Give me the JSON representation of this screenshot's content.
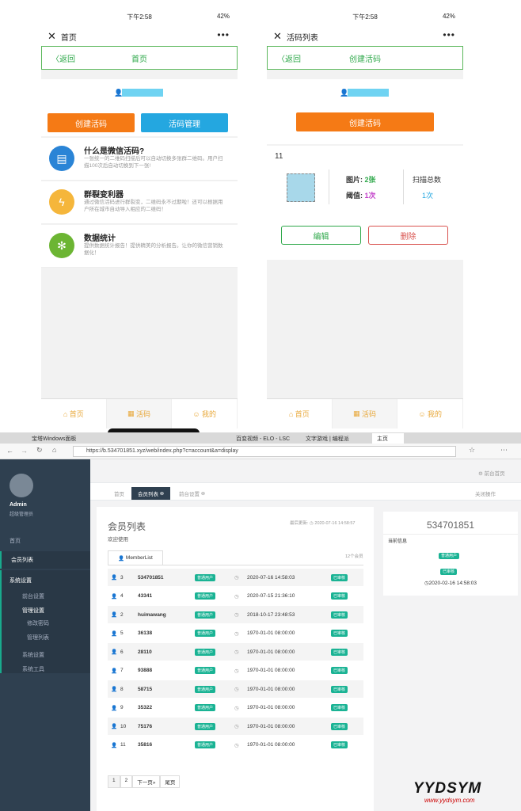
{
  "phone1": {
    "time": "下午2:58",
    "battery": "42",
    "title": "首页",
    "nav_back": "〈返回",
    "nav_title": "首页",
    "btn_create": "创建活码",
    "btn_manage": "活码管理",
    "items": [
      {
        "title": "什么是微信活码?",
        "desc": "一张统一的二维码扫描后可以自动切换多张群二维码。用户扫描100次后自动切换到下一张!"
      },
      {
        "title": "群裂变利器",
        "desc": "通过微信活码进行群裂变，二维码永不过期啦！还可以根据用户所在城市自动导入相应的二维码！"
      },
      {
        "title": "数据统计",
        "desc": "提供数据统计报告！提供精美的分析报告。让你的微信营销数据化！"
      }
    ],
    "tabs": [
      "首页",
      "活码",
      "我的"
    ]
  },
  "phone2": {
    "time": "下午2:58",
    "battery": "42",
    "title": "活码列表",
    "nav_back": "〈返回",
    "nav_title": "创建活码",
    "btn_create": "创建活码",
    "code_id": "11",
    "img_label": "图片:",
    "img_value": "2张",
    "threshold_label": "阈值:",
    "threshold_value": "1次",
    "scan_label": "扫描总数",
    "scan_value": "1次",
    "btn_edit": "编辑",
    "btn_delete": "删除",
    "tabs": [
      "首页",
      "活码",
      "我的"
    ]
  },
  "browser": {
    "url": "https://b.534701851.xyz/web/index.php?c=account&a=display",
    "tabs": [
      "宝塔Windows面板",
      "百变视频 - ELO - LSC",
      "文字游戏 | 编程派",
      "主页"
    ]
  },
  "admin": {
    "user": "Admin",
    "role": "超级管理员",
    "menu": [
      "首页",
      "会员列表",
      "系统设置",
      "前台设置",
      "管理设置",
      "修改密码",
      "管理列表",
      "系统设置",
      "系统工具"
    ],
    "top_link": "前台首页",
    "tabs": [
      "首页",
      "会员列表",
      "前台设置"
    ],
    "close_ops": "关闭操作",
    "page_title": "会员列表",
    "welcome": "欢迎使用",
    "last_update": "最后更新: ◷ 2020-07-16 14:58:57",
    "member_count": "12个会员",
    "list_tab": "MemberList",
    "badge_normal": "普通用户",
    "badge_review": "已审核",
    "rows": [
      {
        "id": "3",
        "name": "534701851",
        "date": "2020-07-16 14:58:03"
      },
      {
        "id": "4",
        "name": "43341",
        "date": "2020-07-15 21:36:10"
      },
      {
        "id": "2",
        "name": "huimawang",
        "date": "2018-10-17 23:48:53"
      },
      {
        "id": "5",
        "name": "36138",
        "date": "1970-01-01 08:00:00"
      },
      {
        "id": "6",
        "name": "28110",
        "date": "1970-01-01 08:00:00"
      },
      {
        "id": "7",
        "name": "93888",
        "date": "1970-01-01 08:00:00"
      },
      {
        "id": "8",
        "name": "58715",
        "date": "1970-01-01 08:00:00"
      },
      {
        "id": "9",
        "name": "35322",
        "date": "1970-01-01 08:00:00"
      },
      {
        "id": "10",
        "name": "75176",
        "date": "1970-01-01 08:00:00"
      },
      {
        "id": "11",
        "name": "35816",
        "date": "1970-01-01 08:00:00"
      }
    ],
    "pager": [
      "1",
      "2",
      "下一页»",
      "尾页"
    ],
    "side_title": "534701851",
    "side_info": "当前信息",
    "side_date": "◷2020-02-16 14:58:03"
  },
  "watermark": {
    "logo": "YYDSYM",
    "site": "www.yydsym.com"
  }
}
